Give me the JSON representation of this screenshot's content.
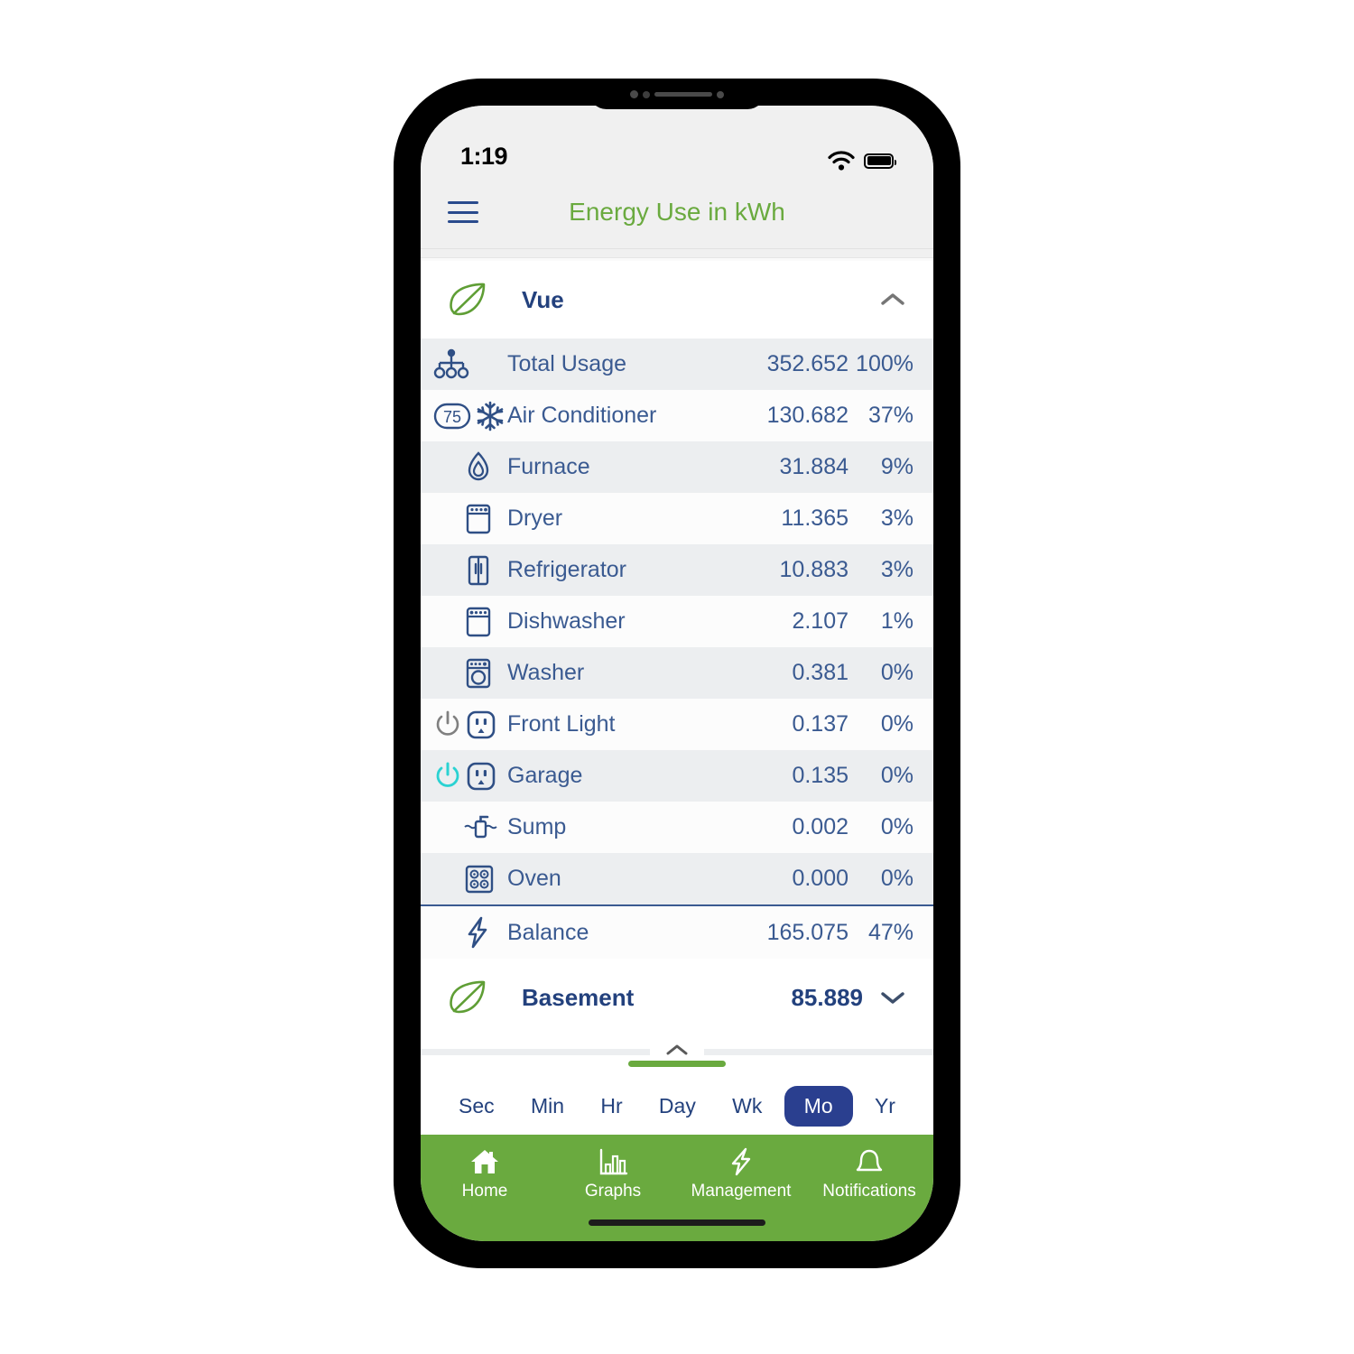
{
  "status_bar": {
    "time": "1:19",
    "wifi_icon": "wifi-icon",
    "battery_icon": "battery-full-icon"
  },
  "header": {
    "menu_icon": "hamburger-menu-icon",
    "title": "Energy Use in kWh",
    "title_color": "#6aaa3f"
  },
  "sections": [
    {
      "name": "Vue",
      "leaf_icon": "leaf-icon",
      "value": "",
      "expanded": true,
      "toggle_icon": "chevron-up-icon"
    },
    {
      "name": "Basement",
      "leaf_icon": "leaf-icon",
      "value": "85.889",
      "expanded": false,
      "toggle_icon": "chevron-down-icon"
    }
  ],
  "rows": [
    {
      "label": "Total Usage",
      "value": "352.652",
      "percent": "100%",
      "icon": "hierarchy-icon",
      "indent": false,
      "badge": "",
      "power": ""
    },
    {
      "label": "Air Conditioner",
      "value": "130.682",
      "percent": "37%",
      "icon": "snowflake-icon",
      "indent": false,
      "badge": "75",
      "power": ""
    },
    {
      "label": "Furnace",
      "value": "31.884",
      "percent": "9%",
      "icon": "flame-icon",
      "indent": true,
      "badge": "",
      "power": ""
    },
    {
      "label": "Dryer",
      "value": "11.365",
      "percent": "3%",
      "icon": "dryer-icon",
      "indent": true,
      "badge": "",
      "power": ""
    },
    {
      "label": "Refrigerator",
      "value": "10.883",
      "percent": "3%",
      "icon": "refrigerator-icon",
      "indent": true,
      "badge": "",
      "power": ""
    },
    {
      "label": "Dishwasher",
      "value": "2.107",
      "percent": "1%",
      "icon": "dishwasher-icon",
      "indent": true,
      "badge": "",
      "power": ""
    },
    {
      "label": "Washer",
      "value": "0.381",
      "percent": "0%",
      "icon": "washer-icon",
      "indent": true,
      "badge": "",
      "power": ""
    },
    {
      "label": "Front Light",
      "value": "0.137",
      "percent": "0%",
      "icon": "outlet-icon",
      "indent": false,
      "badge": "",
      "power": "off"
    },
    {
      "label": "Garage",
      "value": "0.135",
      "percent": "0%",
      "icon": "outlet-icon",
      "indent": false,
      "badge": "",
      "power": "on"
    },
    {
      "label": "Sump",
      "value": "0.002",
      "percent": "0%",
      "icon": "sump-pump-icon",
      "indent": true,
      "badge": "",
      "power": ""
    },
    {
      "label": "Oven",
      "value": "0.000",
      "percent": "0%",
      "icon": "stove-icon",
      "indent": true,
      "badge": "",
      "power": ""
    },
    {
      "label": "Balance",
      "value": "165.075",
      "percent": "47%",
      "icon": "bolt-icon",
      "indent": true,
      "badge": "",
      "power": ""
    }
  ],
  "drag_handle": {
    "chevron_icon": "chevron-up-icon",
    "bar_color": "#6aaa3f"
  },
  "time_selector": {
    "selected": "Mo",
    "options": [
      "Sec",
      "Min",
      "Hr",
      "Day",
      "Wk",
      "Mo",
      "Yr"
    ],
    "active_bg": "#2a3f8f"
  },
  "tabbar": {
    "bg_color": "#6aaa3f",
    "items": [
      {
        "label": "Home",
        "icon": "house-icon",
        "active": true
      },
      {
        "label": "Graphs",
        "icon": "bar-chart-icon",
        "active": false
      },
      {
        "label": "Management",
        "icon": "bolt-icon",
        "active": false
      },
      {
        "label": "Notifications",
        "icon": "bell-icon",
        "active": false
      }
    ]
  },
  "colors": {
    "accent_green": "#6aaa3f",
    "text_blue": "#3a5a91",
    "header_blue": "#23417d",
    "power_on": "#2ad2d2",
    "power_off": "#808080"
  }
}
